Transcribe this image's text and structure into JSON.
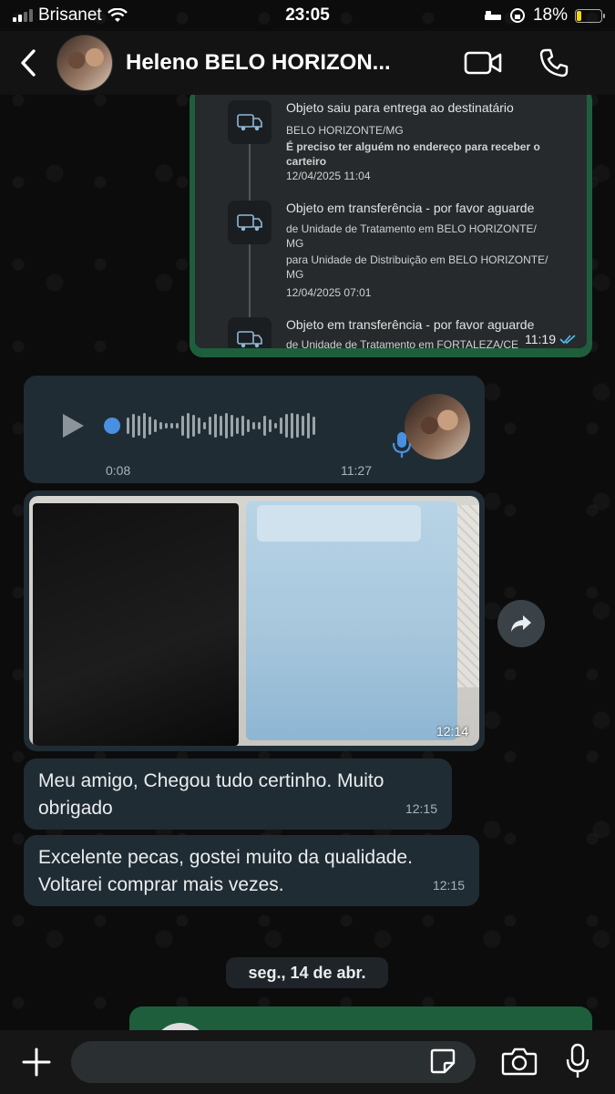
{
  "status_bar": {
    "carrier": "Brisanet",
    "time": "23:05",
    "battery_percent": "18%",
    "battery_level": 0.18
  },
  "header": {
    "contact_name": "Heleno BELO HORIZON..."
  },
  "tracking": {
    "events": [
      {
        "title": "Objeto saiu para entrega ao destinatário",
        "line1": "BELO HORIZONTE/MG",
        "line2": "É preciso ter alguém no endereço para receber o",
        "line3": "carteiro",
        "date": "12/04/2025 11:04"
      },
      {
        "title": "Objeto em transferência - por favor aguarde",
        "line1": "de Unidade de Tratamento em BELO HORIZONTE/",
        "line2": "MG",
        "line3": "para Unidade de Distribuição em BELO HORIZONTE/",
        "line4": "MG",
        "date": "12/04/2025 07:01"
      },
      {
        "title": "Objeto em transferência - por favor aguarde",
        "line1": "de Unidade de Tratamento em FORTALEZA/CE"
      }
    ],
    "time": "11:19"
  },
  "voice_message": {
    "duration": "0:08",
    "time": "11:27"
  },
  "photo_message": {
    "time": "12:14"
  },
  "messages": [
    {
      "text_line1": "Meu amigo, Chegou tudo certinho. Muito",
      "text_line2": "obrigado",
      "time": "12:15"
    },
    {
      "text_line1": "Excelente pecas, gostei muito da qualidade.",
      "text_line2": "Voltarei comprar mais vezes.",
      "time": "12:15"
    }
  ],
  "date_separator": "seg., 14 de abr.",
  "input": {
    "value": ""
  },
  "colors": {
    "outgoing_bubble": "#1f5e3c",
    "incoming_bubble": "#202c33",
    "read_ticks": "#53bdeb",
    "voice_dot": "#4a90e2"
  },
  "icons": [
    "back-icon",
    "video-call-icon",
    "phone-icon",
    "truck-icon",
    "play-icon",
    "mic-icon",
    "forward-icon",
    "plus-icon",
    "sticker-icon",
    "camera-icon",
    "double-check-icon"
  ]
}
